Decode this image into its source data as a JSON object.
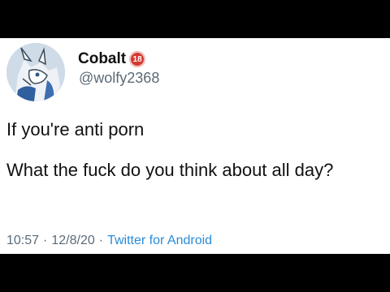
{
  "tweet": {
    "display_name": "Cobalt",
    "badge_text": "18",
    "handle": "@wolfy2368",
    "line1": "If you're anti porn",
    "line2": "What the fuck do you think about all day?",
    "time": "10:57",
    "date": "12/8/20",
    "separator": "·",
    "source": "Twitter for Android"
  },
  "colors": {
    "link": "#2a8bd8",
    "muted": "#5b6b78",
    "badge": "#d43a2f"
  },
  "icons": {
    "avatar": "wolf-avatar",
    "badge": "age-18-badge-icon"
  }
}
